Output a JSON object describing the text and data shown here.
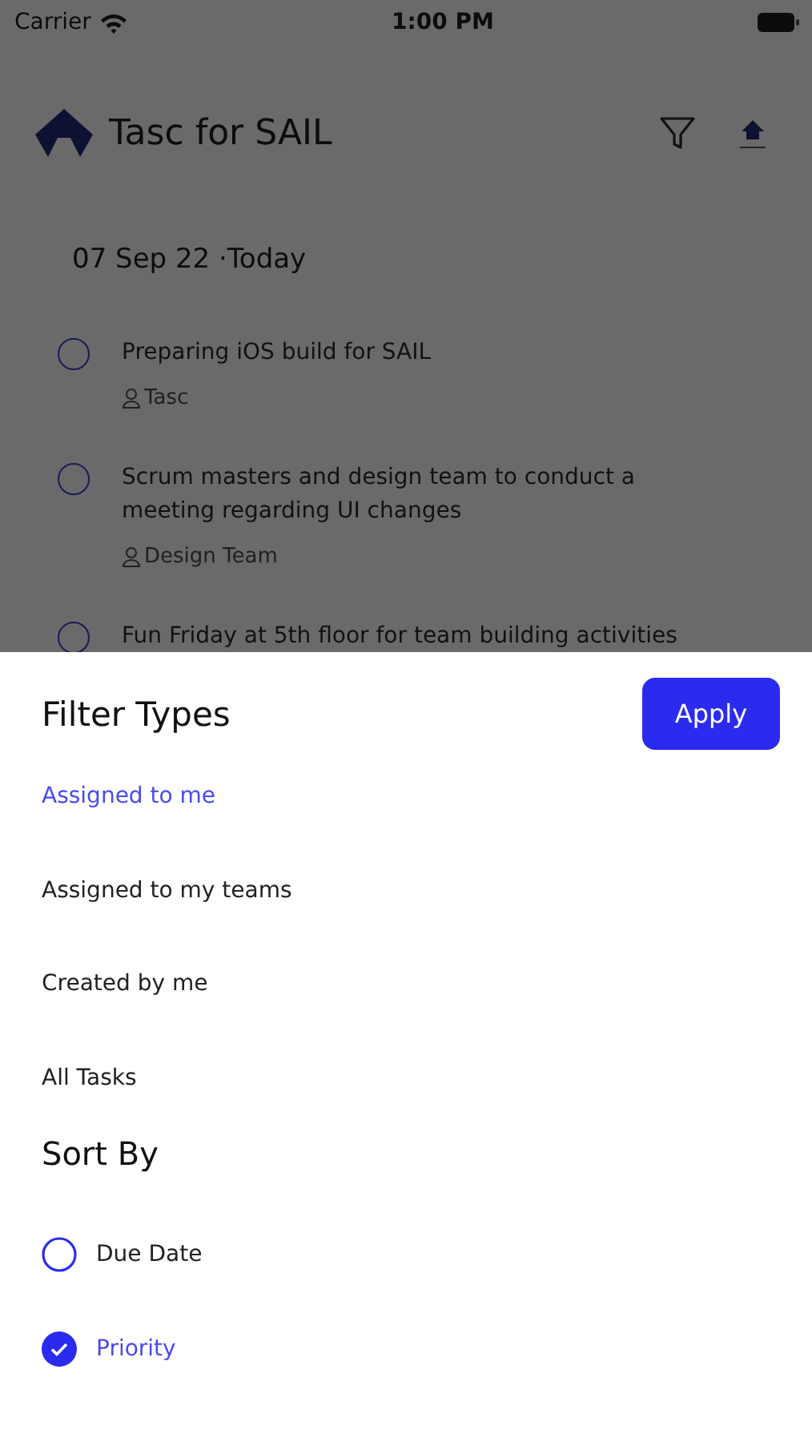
{
  "status_bar": {
    "carrier": "Carrier",
    "time": "1:00 PM"
  },
  "header": {
    "title": "Tasc for SAIL"
  },
  "date_heading": "07 Sep 22 ·Today",
  "tasks": [
    {
      "title": "Preparing iOS build for SAIL",
      "assignee": "Tasc",
      "checked": false
    },
    {
      "title": "Scrum masters and design team to conduct a meeting regarding UI changes",
      "assignee": "Design Team",
      "checked": false
    },
    {
      "title": "Fun Friday at 5th floor for team building activities",
      "checked": false
    }
  ],
  "sheet": {
    "title": "Filter Types",
    "apply_button": "Apply",
    "filters": [
      {
        "label": "Assigned to me",
        "selected": true
      },
      {
        "label": "Assigned to my teams",
        "selected": false
      },
      {
        "label": "Created by me",
        "selected": false
      },
      {
        "label": "All Tasks",
        "selected": false
      }
    ],
    "sort_title": "Sort By",
    "sort_options": [
      {
        "label": "Due Date",
        "selected": false
      },
      {
        "label": "Priority",
        "selected": true
      }
    ]
  }
}
